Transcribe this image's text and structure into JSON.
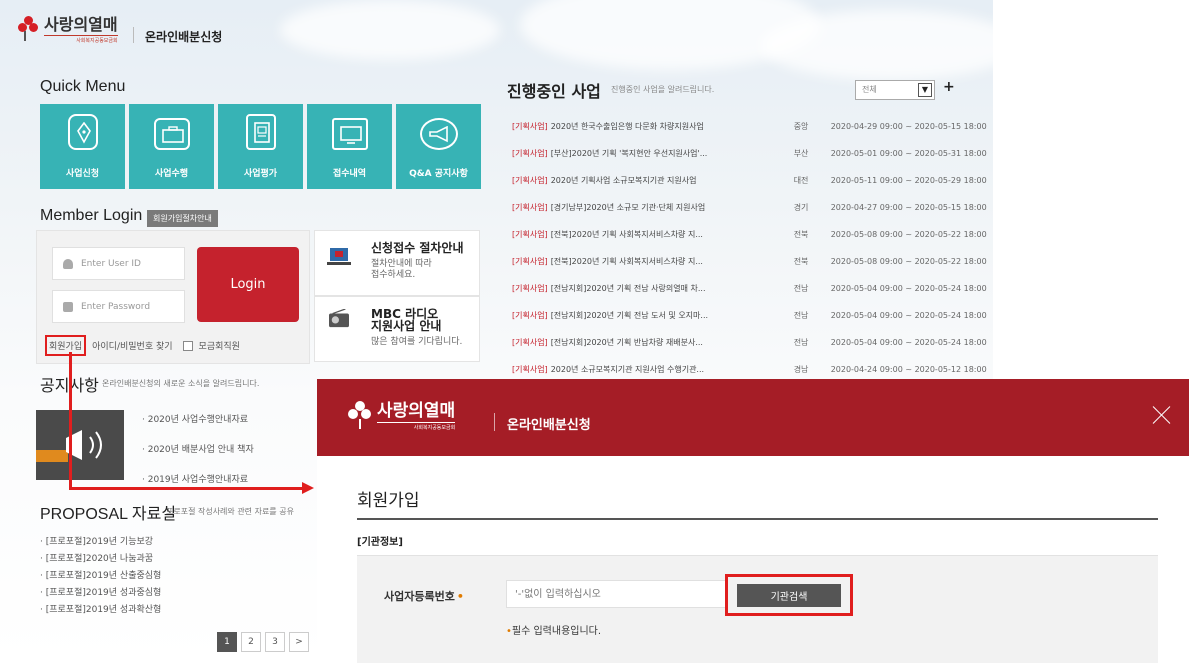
{
  "portal": {
    "logo_name": "사랑의열매",
    "logo_sub": "사회복지공동모금회",
    "service_title": "온라인배분신청",
    "quick_menu": {
      "title": "Quick Menu",
      "items": [
        {
          "label": "사업신청",
          "icon": "pen-nib-icon"
        },
        {
          "label": "사업수행",
          "icon": "briefcase-icon"
        },
        {
          "label": "사업평가",
          "icon": "document-icon"
        },
        {
          "label": "접수내역",
          "icon": "monitor-icon"
        },
        {
          "label": "Q&A 공지사항",
          "icon": "megaphone-icon"
        }
      ]
    },
    "member_login": {
      "title": "Member Login",
      "guide_button": "회원가입절차안내",
      "user_placeholder": "Enter User ID",
      "password_placeholder": "Enter Password",
      "login_button": "Login",
      "signup_link": "회원가입",
      "find_link": "아이디/비밀번호 찾기",
      "fundraiser_label": "모금회직원"
    },
    "guides": [
      {
        "title": "신청접수 절차안내",
        "sub1": "절차안내에 따라",
        "sub2": "접수하세요."
      },
      {
        "title": "MBC 라디오",
        "title2": "지원사업 안내",
        "sub1": "많은 참여를 기다립니다."
      }
    ],
    "notice": {
      "title": "공지사항",
      "subtitle": "온라인배분신청의 새로운 소식을 알려드립니다.",
      "items": [
        "· 2020년 사업수행안내자료",
        "· 2020년 배분사업 안내 책자",
        "· 2019년 사업수행안내자료"
      ]
    },
    "proposal": {
      "title": "PROPOSAL 자료실",
      "subtitle": "프로포절 작성사례와 관련 자료를 공유",
      "items": [
        "· [프로포절]2019년 기능보강",
        "· [프로포절]2020년 나눔과꿈",
        "· [프로포절]2019년 산출중심형",
        "· [프로포절]2019년 성과중심형",
        "· [프로포절]2019년 성과확산형"
      ],
      "pages": [
        "1",
        "2",
        "3",
        ">"
      ]
    },
    "projects": {
      "title": "진행중인 사업",
      "subtitle": "진행중인 사업을 알려드립니다.",
      "filter": "전체",
      "plus": "+",
      "rows": [
        {
          "tag": "[기획사업]",
          "title": "2020년 한국수출입은행 다문화 차량지원사업",
          "region": "중앙",
          "date": "2020-04-29 09:00 ~ 2020-05-15 18:00"
        },
        {
          "tag": "[기획사업]",
          "title": "[부산]2020년 기획 '복지현안 우선지원사업'...",
          "region": "부산",
          "date": "2020-05-01 09:00 ~ 2020-05-31 18:00"
        },
        {
          "tag": "[기획사업]",
          "title": "2020년 기획사업 소규모복지기관 지원사업",
          "region": "대전",
          "date": "2020-05-11 09:00 ~ 2020-05-29 18:00"
        },
        {
          "tag": "[기획사업]",
          "title": "[경기남부]2020년 소규모 기관·단체 지원사업",
          "region": "경기",
          "date": "2020-04-27 09:00 ~ 2020-05-15 18:00"
        },
        {
          "tag": "[기획사업]",
          "title": "[전북]2020년 기획 사회복지서비스차량 지...",
          "region": "전북",
          "date": "2020-05-08 09:00 ~ 2020-05-22 18:00"
        },
        {
          "tag": "[기획사업]",
          "title": "[전북]2020년 기획 사회복지서비스차량 지...",
          "region": "전북",
          "date": "2020-05-08 09:00 ~ 2020-05-22 18:00"
        },
        {
          "tag": "[기획사업]",
          "title": "[전남지회]2020년 기획 전남 사랑의열매 차...",
          "region": "전남",
          "date": "2020-05-04 09:00 ~ 2020-05-24 18:00"
        },
        {
          "tag": "[기획사업]",
          "title": "[전남지회]2020년 기획 전남 도서 및 오지마...",
          "region": "전남",
          "date": "2020-05-04 09:00 ~ 2020-05-24 18:00"
        },
        {
          "tag": "[기획사업]",
          "title": "[전남지회]2020년 기획 반납차량 재배분사...",
          "region": "전남",
          "date": "2020-05-04 09:00 ~ 2020-05-24 18:00"
        },
        {
          "tag": "[기획사업]",
          "title": "2020년 소규모복지기관 지원사업 수행기관...",
          "region": "경남",
          "date": "2020-04-24 09:00 ~ 2020-05-12 18:00"
        }
      ]
    }
  },
  "popup": {
    "logo_name": "사랑의열매",
    "logo_sub": "사회복지공동모금회",
    "service_title": "온라인배분신청",
    "title": "회원가입",
    "section": "[기관정보]",
    "field_label": "사업자등록번호",
    "required_mark": "•",
    "field_placeholder": "'-'없이 입력하십시오",
    "search_button": "기관검색",
    "required_note": "필수 입력내용입니다.",
    "required_note_mark": "•"
  },
  "colors": {
    "brand_red": "#a51d26",
    "login_red": "#c5222d",
    "tile_teal": "#37b3b5",
    "highlight_red": "#e01e1e",
    "required_orange": "#e07b00"
  }
}
